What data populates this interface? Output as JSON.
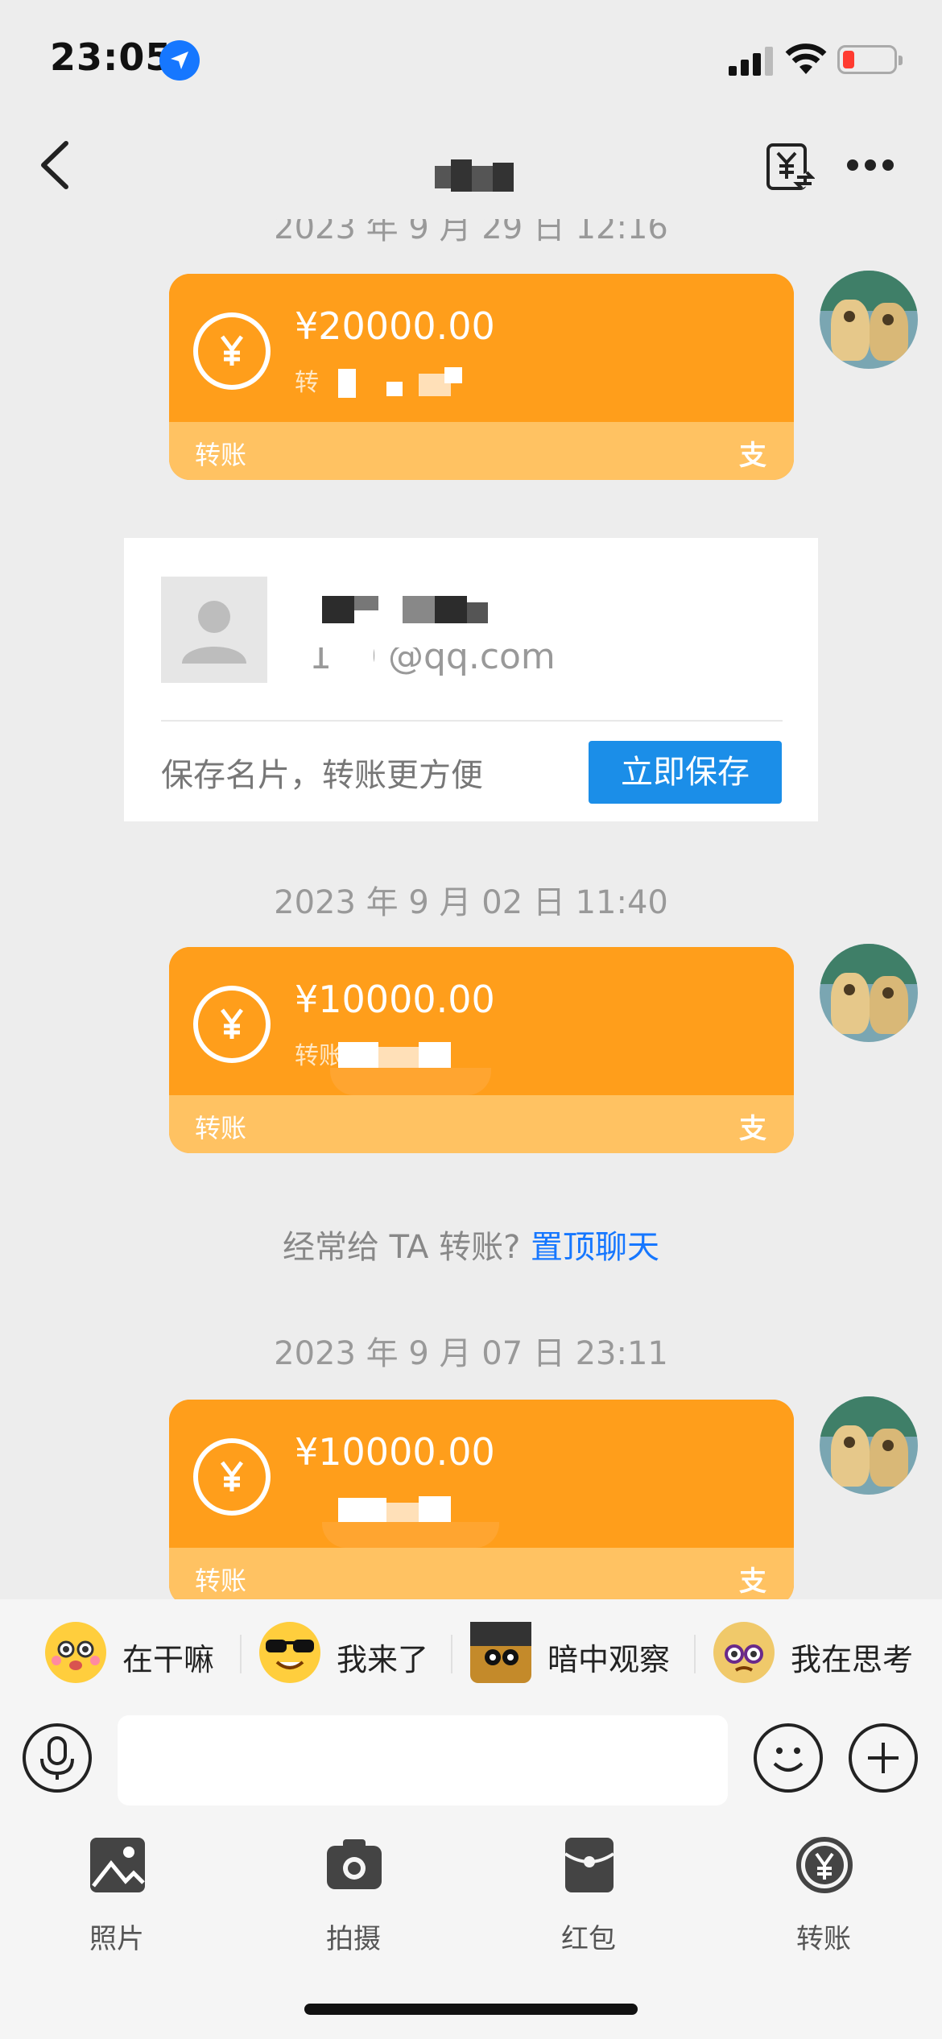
{
  "status": {
    "time": "23:05"
  },
  "header": {
    "title": ""
  },
  "messages": [
    {
      "timestamp": "2023 年 9 月 29 日 12:16",
      "amount": "¥20000.00",
      "note": "转",
      "label": "转账",
      "brand": "支"
    },
    {
      "timestamp": "2023 年 9 月 02 日 11:40",
      "amount": "¥10000.00",
      "note": "转账",
      "label": "转账",
      "brand": "支"
    },
    {
      "timestamp": "2023 年 9 月 07 日 23:11",
      "amount": "¥10000.00",
      "note": "",
      "label": "转账",
      "brand": "支"
    }
  ],
  "contact_card": {
    "email": "170 @qq.com",
    "hint": "保存名片，转账更方便",
    "save_label": "立即保存"
  },
  "pin_tip": {
    "text": "经常给 TA 转账? ",
    "link": "置顶聊天"
  },
  "suggestions": [
    {
      "label": "在干嘛",
      "emoji": "face-shy"
    },
    {
      "label": "我来了",
      "emoji": "face-sunglasses"
    },
    {
      "label": "暗中观察",
      "emoji": "face-peek"
    },
    {
      "label": "我在思考",
      "emoji": "face-thinking"
    }
  ],
  "toolbar": [
    {
      "label": "照片",
      "icon": "photo-icon"
    },
    {
      "label": "拍摄",
      "icon": "camera-icon"
    },
    {
      "label": "红包",
      "icon": "red-packet-icon"
    },
    {
      "label": "转账",
      "icon": "transfer-icon"
    }
  ],
  "colors": {
    "card": "#ff9e1b",
    "card_footer": "#ffc262",
    "link": "#1677ff",
    "save_button": "#1b8ee8"
  }
}
